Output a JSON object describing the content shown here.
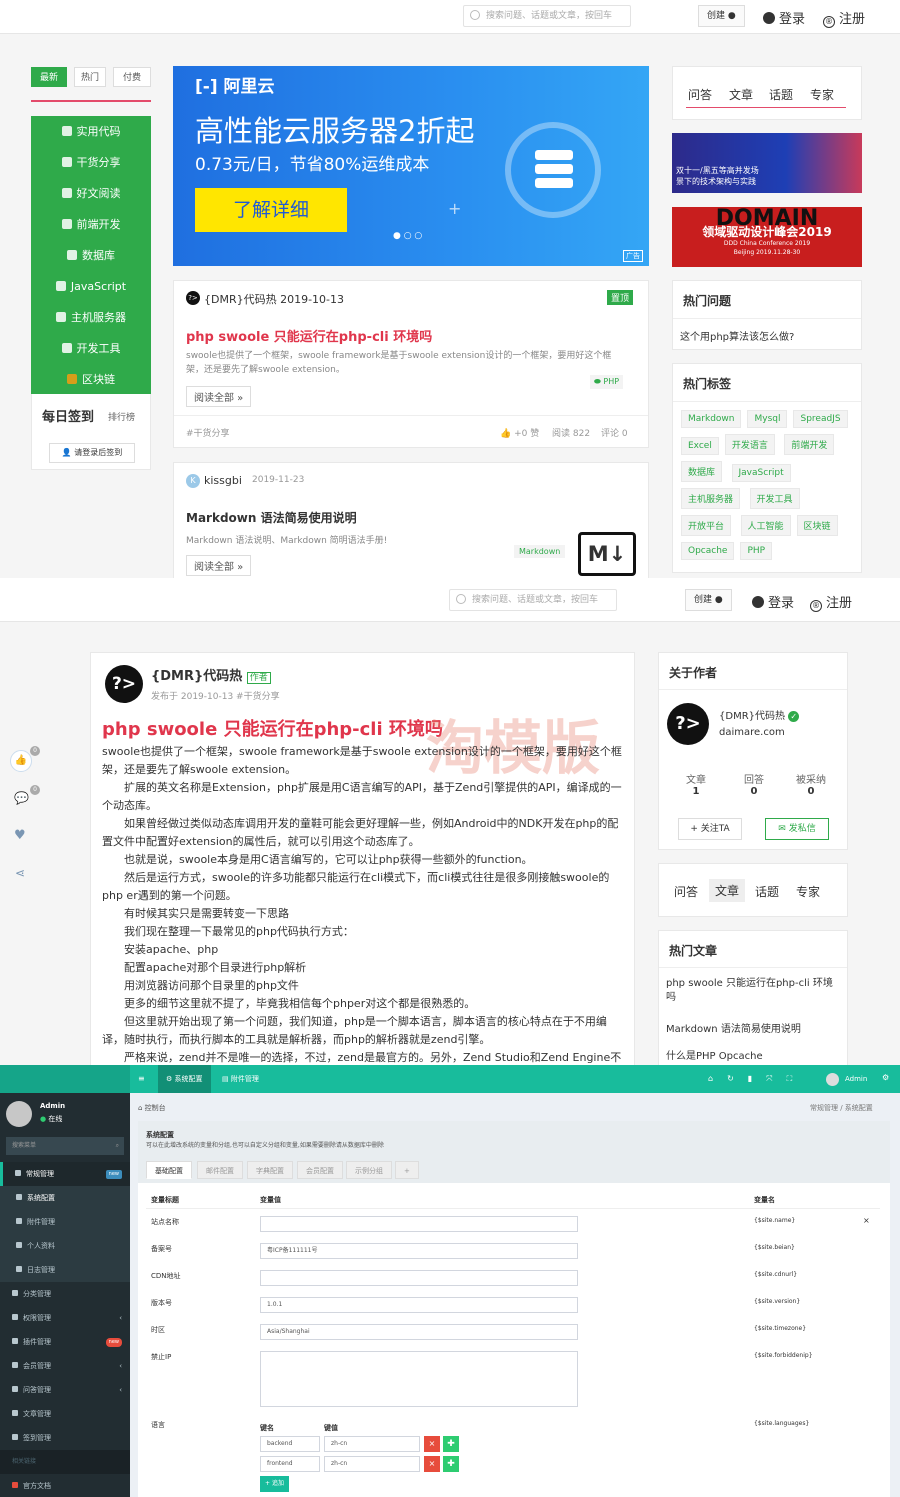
{
  "p1": {
    "search_placeholder": "搜索问题、话题或文章，按回车",
    "create": "创建",
    "login": "登录",
    "register": "注册",
    "left_tabs": [
      "最新",
      "热门",
      "付费"
    ],
    "menu": [
      "实用代码",
      "干货分享",
      "好文阅读",
      "前端开发",
      "数据库",
      "JavaScript",
      "主机服务器",
      "开发工具",
      "区块链"
    ],
    "signin_title": "每日签到",
    "signin_rank": "排行榜",
    "signin_btn": "请登录后签到",
    "banner": {
      "brand": "阿里云",
      "headline": "高性能云服务器2折起",
      "sub": "0.73元/日，节省80%运维成本",
      "cta": "了解详细",
      "ad": "广告"
    },
    "post1": {
      "author": "{DMR}代码热 2019-10-13",
      "badge": "置顶",
      "title": "php swoole 只能运行在php-cli 环境吗",
      "excerpt": "swoole也提供了一个框架，swoole framework是基于swoole extension设计的一个框架，要用好这个框架，还是要先了解swoole extension。",
      "tag": "PHP",
      "read": "阅读全部",
      "category": "#干货分享",
      "likes": "+0 赞",
      "views": "阅读 822",
      "comments": "评论 0"
    },
    "post2": {
      "author": "kissgbi",
      "date": "2019-11-23",
      "title": "Markdown 语法简易使用说明",
      "excerpt": "Markdown 语法说明、Markdown 简明语法手册!",
      "tag": "Markdown",
      "read": "阅读全部"
    },
    "right_tabs": [
      "问答",
      "文章",
      "话题",
      "专家"
    ],
    "ad1": [
      "双十一/黑五等高并发场",
      "景下的技术架构与实践"
    ],
    "ad2": {
      "big": "DOMAIN",
      "title": "领域驱动设计峰会2019",
      "sub": "DDD China Conference 2019",
      "place": "Beijing 2019.11.28-30"
    },
    "hot_q_title": "热门问题",
    "hot_q": "这个用php算法该怎么做?",
    "hot_tags_title": "热门标签",
    "tags": [
      "Markdown",
      "Mysql",
      "SpreadJS",
      "Excel",
      "开发语言",
      "前端开发",
      "数据库",
      "JavaScript",
      "主机服务器",
      "开发工具",
      "开放平台",
      "人工智能",
      "区块链",
      "Opcache",
      "PHP"
    ]
  },
  "p2": {
    "search_placeholder": "搜索问题、话题或文章，按回车",
    "create": "创建",
    "login": "登录",
    "register": "注册",
    "author": "{DMR}代码热",
    "author_badge": "作者",
    "meta": "发布于 2019-10-13 #干货分享",
    "title": "php swoole 只能运行在php-cli 环境吗",
    "watermark": "淘模版",
    "side_counts": [
      "0",
      "0"
    ],
    "paragraphs": [
      "swoole也提供了一个框架，swoole framework是基于swoole extension设计的一个框架，要用好这个框架，还是要先了解swoole extension。",
      "扩展的英文名称是Extension，php扩展是用C语言编写的API，基于Zend引擎提供的API，编译成的一个动态库。",
      "如果曾经做过类似动态库调用开发的童鞋可能会更好理解一些，例如Android中的NDK开发在php的配置文件中配置好extension的属性后，就可以引用这个动态库了。",
      "也就是说，swoole本身是用C语言编写的，它可以让php获得一些额外的function。",
      "然后是运行方式，swoole的许多功能都只能运行在cli模式下，而cli模式往往是很多刚接触swoole的php er遇到的第一个问题。",
      "有时候其实只是需要转变一下思路",
      "我们现在整理一下最常见的php代码执行方式：",
      "安装apache、php",
      "配置apache对那个目录进行php解析",
      "用浏览器访问那个目录里的php文件",
      "更多的细节这里就不提了，毕竟我相信每个phper对这个都是很熟悉的。",
      "但这里就开始出现了第一个问题，我们知道，php是一个脚本语言，脚本语言的核心特点在于不用编译，随时执行，而执行脚本的工具就是解析器，而php的解析器就是zend引擎。",
      "严格来说，zend并不是唯一的选择，不过，zend是最官方的。另外，Zend Studio和Zend Engine不是"
    ],
    "about_title": "关于作者",
    "about_name": "{DMR}代码热",
    "about_site": "daimare.com",
    "stats": [
      {
        "label": "文章",
        "value": "1"
      },
      {
        "label": "回答",
        "value": "0"
      },
      {
        "label": "被采纳",
        "value": "0"
      }
    ],
    "follow": "关注TA",
    "message": "发私信",
    "right_tabs": [
      "问答",
      "文章",
      "话题",
      "专家"
    ],
    "hot_title": "热门文章",
    "hot_list": [
      "php swoole 只能运行在php-cli 环境吗",
      "Markdown 语法简易使用说明",
      "什么是PHP Opcache"
    ]
  },
  "p3": {
    "top_tabs": [
      "系统配置",
      "附件管理"
    ],
    "user": "Admin",
    "status": "在线",
    "search": "搜索菜单",
    "menu": [
      {
        "label": "常规管理",
        "badge": "new"
      },
      {
        "label": "系统配置"
      },
      {
        "label": "附件管理"
      },
      {
        "label": "个人资料"
      },
      {
        "label": "日志管理"
      },
      {
        "label": "分类管理"
      },
      {
        "label": "权限管理"
      },
      {
        "label": "插件管理",
        "badge": "new"
      },
      {
        "label": "会员管理"
      },
      {
        "label": "问答管理"
      },
      {
        "label": "文章管理"
      },
      {
        "label": "签到管理"
      }
    ],
    "section_label": "相关链接",
    "docs": "官方文档",
    "crumb": "控制台",
    "crumb_right": "常规管理 / 系统配置",
    "panel_title": "系统配置",
    "panel_desc": "可以在此增改系统的变量和分组,也可以自定义分组和变量,如果需要删除请从数据库中删除",
    "tabs": [
      "基础配置",
      "邮件配置",
      "字典配置",
      "会员配置",
      "示例分组",
      "+"
    ],
    "cols": [
      "变量标题",
      "变量值",
      "变量名"
    ],
    "rows": [
      {
        "label": "站点名称",
        "value": "",
        "name": "{$site.name}"
      },
      {
        "label": "备案号",
        "value": "粤ICP备111111号",
        "name": "{$site.beian}"
      },
      {
        "label": "CDN地址",
        "value": "",
        "name": "{$site.cdnurl}"
      },
      {
        "label": "版本号",
        "value": "1.0.1",
        "name": "{$site.version}"
      },
      {
        "label": "时区",
        "value": "Asia/Shanghai",
        "name": "{$site.timezone}"
      },
      {
        "label": "禁止IP",
        "value": "",
        "name": "{$site.forbiddenip}"
      }
    ],
    "lang_label": "语言",
    "lang_name": "{$site.languages}",
    "kv_head": [
      "键名",
      "键值"
    ],
    "kv": [
      [
        "backend",
        "zh-cn"
      ],
      [
        "frontend",
        "zh-cn"
      ]
    ],
    "add": "追加",
    "top_right_user": "Admin"
  }
}
